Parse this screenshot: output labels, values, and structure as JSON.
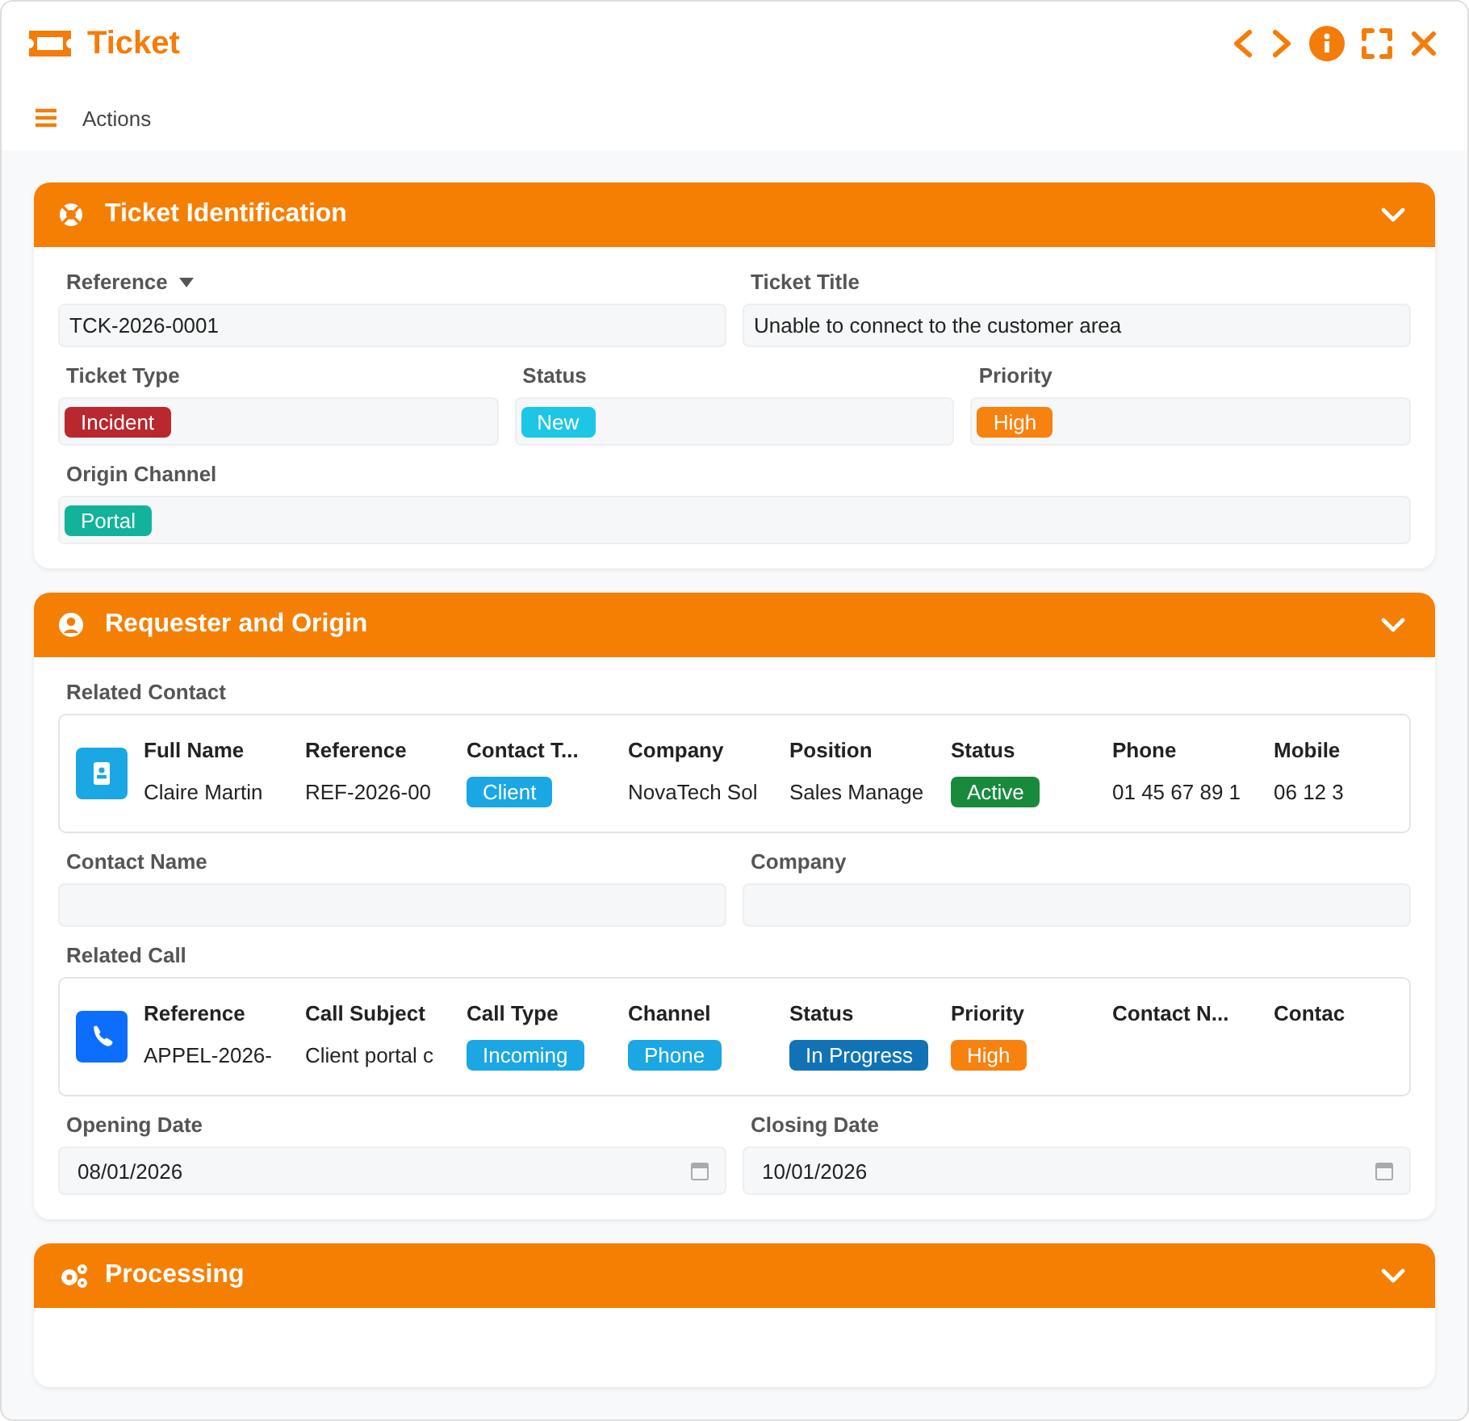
{
  "window": {
    "title": "Ticket"
  },
  "toolbar": {
    "label": "Actions"
  },
  "sections": [
    {
      "title": "Ticket Identification",
      "expanded": true,
      "rows": [
        {
          "fields": [
            {
              "kind": "text",
              "label": "Reference",
              "dropdown": true,
              "value": "TCK-2026-0001"
            },
            {
              "kind": "text",
              "label": "Ticket Title",
              "value": "Unable to connect to the customer area"
            }
          ]
        },
        {
          "fields": [
            {
              "kind": "badge",
              "label": "Ticket Type",
              "badge": {
                "text": "Incident",
                "color": "#b8282e"
              }
            },
            {
              "kind": "badge",
              "label": "Status",
              "badge": {
                "text": "New",
                "color": "#1ec6e6"
              }
            },
            {
              "kind": "badge",
              "label": "Priority",
              "badge": {
                "text": "High",
                "color": "#f7820f"
              }
            }
          ]
        },
        {
          "fields": [
            {
              "kind": "badge",
              "label": "Origin Channel",
              "badge": {
                "text": "Portal",
                "color": "#12b29b"
              }
            }
          ]
        }
      ]
    },
    {
      "title": "Requester and Origin",
      "expanded": true,
      "rows": [
        {
          "fields": [
            {
              "kind": "related",
              "label": "Related Contact",
              "columns": [
                {
                  "header": "Full Name",
                  "value": "Claire Martin"
                },
                {
                  "header": "Reference",
                  "value": "REF-2026-00"
                },
                {
                  "header": "Contact T...",
                  "badge": {
                    "text": "Client",
                    "color": "#1aa7e3"
                  }
                },
                {
                  "header": "Company",
                  "value": "NovaTech Sol"
                },
                {
                  "header": "Position",
                  "value": "Sales Manage"
                },
                {
                  "header": "Status",
                  "badge": {
                    "text": "Active",
                    "color": "#198a3c"
                  }
                },
                {
                  "header": "Phone",
                  "value": "01 45 67 89 1"
                },
                {
                  "header": "Mobile",
                  "value": "06 12 3"
                }
              ]
            }
          ]
        },
        {
          "fields": [
            {
              "kind": "text",
              "label": "Contact Name"
            },
            {
              "kind": "text",
              "label": "Company"
            }
          ]
        },
        {
          "fields": [
            {
              "kind": "related",
              "label": "Related Call",
              "columns": [
                {
                  "header": "Reference",
                  "value": "APPEL-2026-"
                },
                {
                  "header": "Call Subject",
                  "value": "Client portal c"
                },
                {
                  "header": "Call Type",
                  "badge": {
                    "text": "Incoming",
                    "color": "#1aa7e3"
                  }
                },
                {
                  "header": "Channel",
                  "badge": {
                    "text": "Phone",
                    "color": "#1aa7e3"
                  }
                },
                {
                  "header": "Status",
                  "badge": {
                    "text": "In Progress",
                    "color": "#1173b6"
                  }
                },
                {
                  "header": "Priority",
                  "badge": {
                    "text": "High",
                    "color": "#f7820f"
                  }
                },
                {
                  "header": "Contact N..."
                },
                {
                  "header": "Contac"
                }
              ]
            }
          ]
        },
        {
          "fields": [
            {
              "kind": "date",
              "label": "Opening Date",
              "value": "08/01/2026"
            },
            {
              "kind": "date",
              "label": "Closing Date",
              "value": "10/01/2026"
            }
          ]
        }
      ]
    },
    {
      "title": "Processing",
      "expanded": true
    }
  ]
}
